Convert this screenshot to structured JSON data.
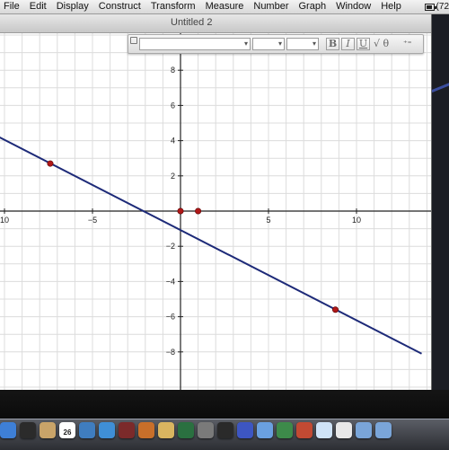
{
  "menubar": {
    "items": [
      "File",
      "Edit",
      "Display",
      "Construct",
      "Transform",
      "Measure",
      "Number",
      "Graph",
      "Window",
      "Help"
    ],
    "battery_text": "(72"
  },
  "window": {
    "title": "Untitled 2"
  },
  "text_palette": {
    "bold_label": "B",
    "italic_label": "I",
    "underline_label": "U",
    "symbols_label": "√ θ"
  },
  "graph": {
    "x_tick_labels": [
      "10",
      "−5",
      "5",
      "10"
    ],
    "y_tick_labels": [
      "8",
      "6",
      "4",
      "2",
      "−2",
      "−4",
      "−6",
      "−8"
    ],
    "line_color": "#1d2a78",
    "point_color": "#b01818",
    "axes_color": "#222222",
    "grid_color": "#dcdcdc",
    "line": {
      "from": [
        -10.3,
        4.2
      ],
      "to": [
        13.7,
        -8.1
      ]
    },
    "points": [
      {
        "x": -7.4,
        "y": 2.7
      },
      {
        "x": 0,
        "y": 0
      },
      {
        "x": 1,
        "y": 0
      },
      {
        "x": 8.8,
        "y": -5.6
      }
    ]
  },
  "dock": {
    "calendar_day": "26",
    "icons": [
      "finder-icon",
      "dashboard-icon",
      "address-book-icon",
      "ical-icon",
      "preview-icon",
      "itunes-icon",
      "photo-booth-icon",
      "iphoto-icon",
      "garageband-icon",
      "time-machine-icon",
      "system-preferences-icon",
      "dictionary-icon",
      "sketchpad-icon",
      "photo-icon",
      "chart-icon",
      "app-icon",
      "safari-icon",
      "chrome-icon",
      "folder-icon",
      "folder-icon-2"
    ],
    "icon_colors": [
      "#3e7fd6",
      "#2b2b2b",
      "#c9a469",
      "#ffffff",
      "#3f7dbf",
      "#3f8fd6",
      "#7b2a2a",
      "#c86f2a",
      "#d9b560",
      "#2a7040",
      "#7a7a7a",
      "#2a2a2a",
      "#3d56c2",
      "#6aa0e0",
      "#3d8a4a",
      "#c24a33",
      "#cfe3f7",
      "#e8e8e8",
      "#7aa5d8",
      "#7aa5d8"
    ]
  }
}
